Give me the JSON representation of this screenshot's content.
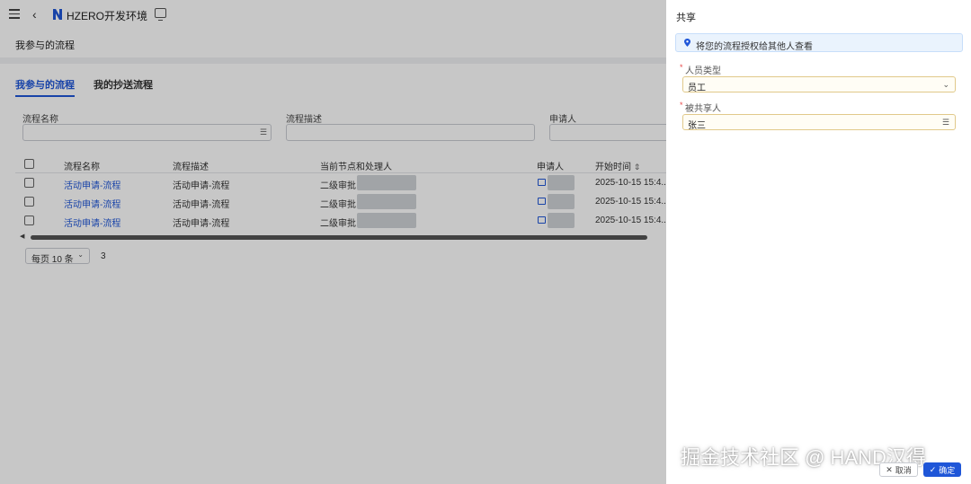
{
  "topbar": {
    "app_name": "HZERO开发环境",
    "back_glyph": "‹"
  },
  "page": {
    "title": "我参与的流程"
  },
  "tabs": [
    {
      "label": "我参与的流程",
      "active": true
    },
    {
      "label": "我的抄送流程",
      "active": false
    }
  ],
  "filters": {
    "process_name_label": "流程名称",
    "process_desc_label": "流程描述",
    "applicant_label": "申请人",
    "lov_glyph": "☰"
  },
  "table": {
    "columns": [
      "流程名称",
      "流程描述",
      "当前节点和处理人",
      "申请人",
      "开始时间"
    ],
    "sort_glyph": "⇕",
    "rows": [
      {
        "name": "活动申请-流程",
        "desc": "活动申请-流程",
        "node": "二级审批",
        "start": "2025-10-15 15:4..."
      },
      {
        "name": "活动申请-流程",
        "desc": "活动申请-流程",
        "node": "二级审批",
        "start": "2025-10-15 15:4..."
      },
      {
        "name": "活动申请-流程",
        "desc": "活动申请-流程",
        "node": "二级审批",
        "start": "2025-10-15 15:4..."
      }
    ]
  },
  "pager": {
    "page_size": "每页 10 条",
    "page_number": "3"
  },
  "panel": {
    "title": "共享",
    "info": "将您的流程授权给其他人查看",
    "person_type_label": "人员类型",
    "person_type_value": "员工",
    "sharee_label": "被共享人",
    "sharee_value": "张三",
    "required_mark": "*",
    "cancel_label": "取消",
    "ok_label": "确定"
  },
  "watermark": "掘金技术社区 @ HAND汉得",
  "colors": {
    "primary": "#1f56d8",
    "required": "#e84b4b",
    "info_bg": "#eaf3fd"
  }
}
